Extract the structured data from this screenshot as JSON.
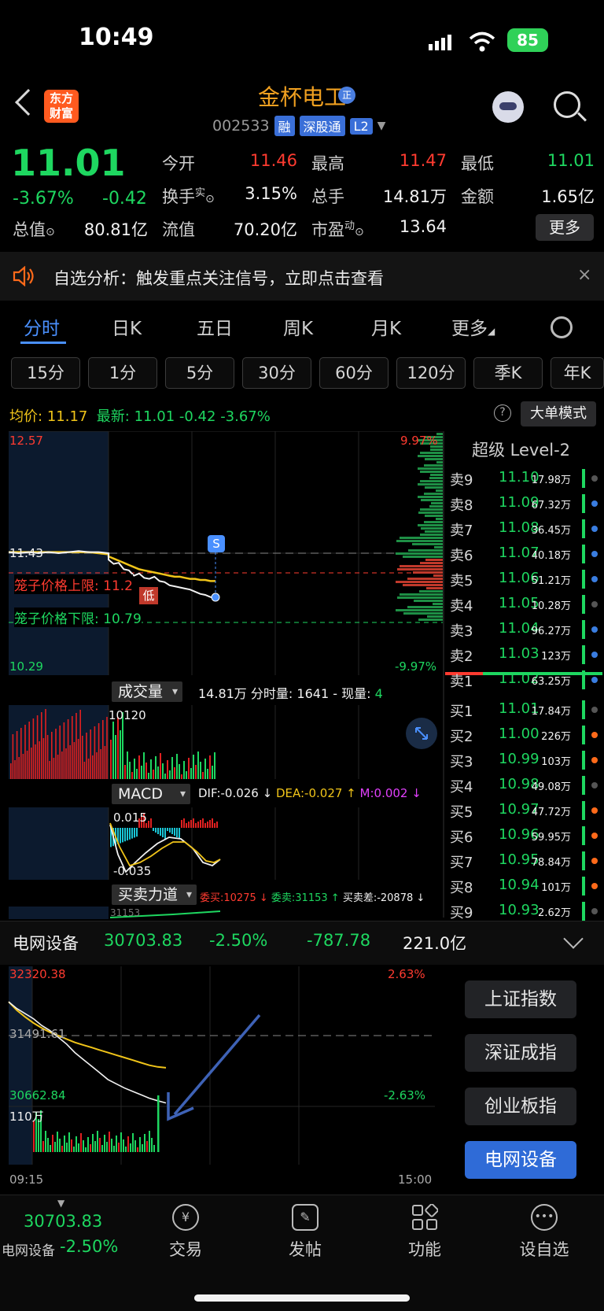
{
  "status": {
    "time": "10:49",
    "battery": "85"
  },
  "header": {
    "logo_line1": "东方",
    "logo_line2": "财富",
    "stock_name": "金杯电工",
    "name_badge": "正",
    "stock_code": "002533",
    "tags": [
      "融",
      "深股通",
      "L2"
    ]
  },
  "quote": {
    "price": "11.01",
    "pct": "-3.67%",
    "change": "-0.42",
    "fields": [
      {
        "label": "今开",
        "value": "11.46",
        "color": "red"
      },
      {
        "label": "最高",
        "value": "11.47",
        "color": "red"
      },
      {
        "label": "最低",
        "value": "11.01",
        "color": "green"
      },
      {
        "label": "换手",
        "value": "3.15%",
        "color": "white"
      },
      {
        "label": "总手",
        "value": "14.81万",
        "color": "white"
      },
      {
        "label": "金额",
        "value": "1.65亿",
        "color": "white"
      },
      {
        "label": "总值",
        "value": "80.81亿",
        "color": "white"
      },
      {
        "label": "流值",
        "value": "70.20亿",
        "color": "white"
      },
      {
        "label": "市盈",
        "value": "13.64",
        "color": "white"
      }
    ],
    "label_sup_shi": "实",
    "label_sup_dong": "动",
    "more": "更多"
  },
  "alert": {
    "text": "自选分析：触发重点关注信号，立即点击查看",
    "close": "×"
  },
  "tabs": [
    "分时",
    "日K",
    "五日",
    "周K",
    "月K",
    "更多"
  ],
  "periods": [
    "15分",
    "1分",
    "5分",
    "30分",
    "60分",
    "120分",
    "季K",
    "年K"
  ],
  "avg_row": {
    "avg_label": "均价:",
    "avg_value": "11.17",
    "latest_label": "最新:",
    "latest_value": "11.01",
    "change": "-0.42",
    "pct": "-3.67%",
    "help": "?",
    "big_order": "大单模式"
  },
  "intraday": {
    "top_price": "12.57",
    "top_pct": "9.97%",
    "bottom_price": "10.29",
    "bottom_pct": "-9.97%",
    "ref_price": "11.43",
    "upper_cage_label": "笼子价格上限: 11.2",
    "lower_cage_label": "笼子价格下限: 10.79",
    "low_marker": "低",
    "s_marker": "S",
    "price_series": [
      11.44,
      11.43,
      11.44,
      11.43,
      11.44,
      11.43,
      11.44,
      11.45,
      11.44,
      11.44,
      11.43,
      11.37,
      11.33,
      11.34,
      11.28,
      11.27,
      11.22,
      11.24,
      11.2,
      11.19,
      11.21,
      11.17,
      11.16,
      11.13,
      11.12,
      11.11,
      11.1,
      11.09,
      11.07,
      11.05,
      11.04,
      11.02,
      11.01
    ],
    "avg_series": [
      11.44,
      11.44,
      11.44,
      11.44,
      11.44,
      11.44,
      11.44,
      11.44,
      11.44,
      11.43,
      11.42,
      11.4,
      11.38,
      11.36,
      11.34,
      11.32,
      11.3,
      11.28,
      11.27,
      11.26,
      11.25,
      11.24,
      11.23,
      11.22,
      11.21,
      11.21,
      11.2,
      11.19,
      11.19,
      11.18,
      11.18,
      11.17,
      11.17
    ]
  },
  "volume": {
    "label": "成交量",
    "total": "14.81万",
    "minute_label": "分时量:",
    "minute_value": "1641",
    "current_label": "现量:",
    "current_value": "4",
    "max": "10120"
  },
  "macd": {
    "label": "MACD",
    "dif": "DIF:-0.026 ↓",
    "dea": "DEA:-0.027 ↑",
    "m": "M:0.002 ↓",
    "top": "0.015",
    "bottom": "-0.035"
  },
  "force": {
    "label": "买卖力道",
    "bid": "委买:10275 ↓",
    "ask": "委卖:31153 ↑",
    "diff": "买卖差:-20878 ↓",
    "value": "31153"
  },
  "level2": {
    "title": "超级 Level-2",
    "asks": [
      {
        "label": "卖9",
        "price": "11.10",
        "vol": "17.98万",
        "dot": "#555555"
      },
      {
        "label": "卖8",
        "price": "11.09",
        "vol": "67.32万",
        "dot": "#3a7de0"
      },
      {
        "label": "卖7",
        "price": "11.08",
        "vol": "36.45万",
        "dot": "#3a7de0"
      },
      {
        "label": "卖6",
        "price": "11.07",
        "vol": "40.18万",
        "dot": "#3a7de0"
      },
      {
        "label": "卖5",
        "price": "11.06",
        "vol": "51.21万",
        "dot": "#3a7de0"
      },
      {
        "label": "卖4",
        "price": "11.05",
        "vol": "10.28万",
        "dot": "#555555"
      },
      {
        "label": "卖3",
        "price": "11.04",
        "vol": "96.27万",
        "dot": "#3a7de0"
      },
      {
        "label": "卖2",
        "price": "11.03",
        "vol": "123万",
        "dot": "#3a7de0"
      },
      {
        "label": "卖1",
        "price": "11.02",
        "vol": "63.25万",
        "dot": "#3a7de0"
      }
    ],
    "bids": [
      {
        "label": "买1",
        "price": "11.01",
        "vol": "17.84万",
        "dot": "#555555"
      },
      {
        "label": "买2",
        "price": "11.00",
        "vol": "226万",
        "dot": "#ff6a1a"
      },
      {
        "label": "买3",
        "price": "10.99",
        "vol": "103万",
        "dot": "#ff6a1a"
      },
      {
        "label": "买4",
        "price": "10.98",
        "vol": "49.08万",
        "dot": "#555555"
      },
      {
        "label": "买5",
        "price": "10.97",
        "vol": "47.72万",
        "dot": "#ff6a1a"
      },
      {
        "label": "买6",
        "price": "10.96",
        "vol": "59.95万",
        "dot": "#ff6a1a"
      },
      {
        "label": "买7",
        "price": "10.95",
        "vol": "78.84万",
        "dot": "#ff6a1a"
      },
      {
        "label": "买8",
        "price": "10.94",
        "vol": "101万",
        "dot": "#ff6a1a"
      },
      {
        "label": "买9",
        "price": "10.93",
        "vol": "2.62万",
        "dot": "#555555"
      }
    ]
  },
  "sector": {
    "name": "电网设备",
    "price": "30703.83",
    "pct": "-2.50%",
    "change": "-787.78",
    "amount": "221.0亿",
    "top": "32320.38",
    "top_pct": "2.63%",
    "ref": "31491.61",
    "bottom": "30662.84",
    "bottom_pct": "-2.63%",
    "vol_max": "110万",
    "time_start": "09:15",
    "time_end": "15:00",
    "price_series": [
      31900,
      31820,
      31760,
      31700,
      31620,
      31560,
      31480,
      31400,
      31300,
      31220,
      31140,
      31060,
      30980,
      30930,
      30880,
      30840,
      30800,
      30760,
      30730,
      30704
    ],
    "avg_series": [
      31900,
      31800,
      31720,
      31650,
      31590,
      31540,
      31500,
      31460,
      31420,
      31390,
      31360,
      31330,
      31300,
      31270,
      31240,
      31210,
      31180,
      31150,
      31130,
      31120
    ]
  },
  "index_buttons": [
    "上证指数",
    "深证成指",
    "创业板指",
    "电网设备"
  ],
  "bottom_nav": {
    "ticker_price": "30703.83",
    "ticker_name": "电网设备",
    "ticker_pct": "-2.50%",
    "items": [
      "交易",
      "发帖",
      "功能",
      "设自选"
    ]
  },
  "colors": {
    "up": "#ff3b30",
    "down": "#1ed760",
    "avg": "#f0c419",
    "accent": "#4a90ff"
  }
}
